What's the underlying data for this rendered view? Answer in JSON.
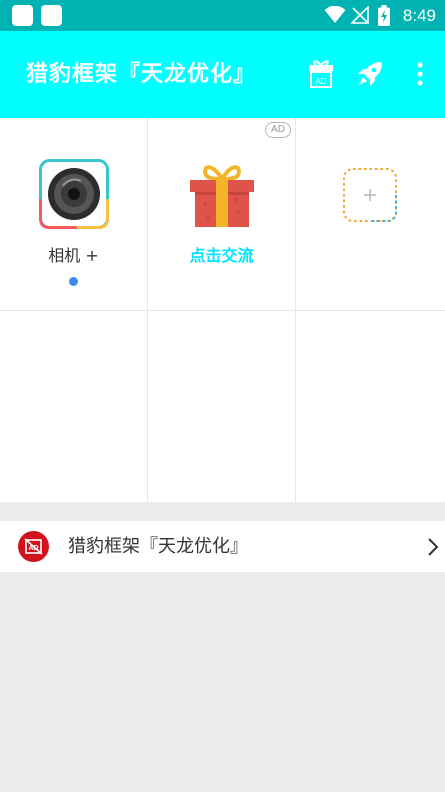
{
  "status_bar": {
    "time": "8:49"
  },
  "app_bar": {
    "title": "猎豹框架『天龙优化』"
  },
  "grid": {
    "ad_badge": "AD",
    "items": [
      {
        "label": "相机 +"
      },
      {
        "label": "点击交流"
      }
    ]
  },
  "list": {
    "item_label": "猎豹框架『天龙优化』"
  },
  "colors": {
    "status_bar": "#00b2b2",
    "app_bar": "#00ffff",
    "accent_text": "#00e5ff",
    "dot": "#3f8cf0"
  },
  "icons": [
    "wifi-icon",
    "signal-icon",
    "battery-icon",
    "gift-ad-icon",
    "rocket-icon",
    "more-vert-icon",
    "camera-app-icon",
    "gift-icon",
    "add-app-icon",
    "ad-block-icon",
    "chevron-right-icon"
  ]
}
